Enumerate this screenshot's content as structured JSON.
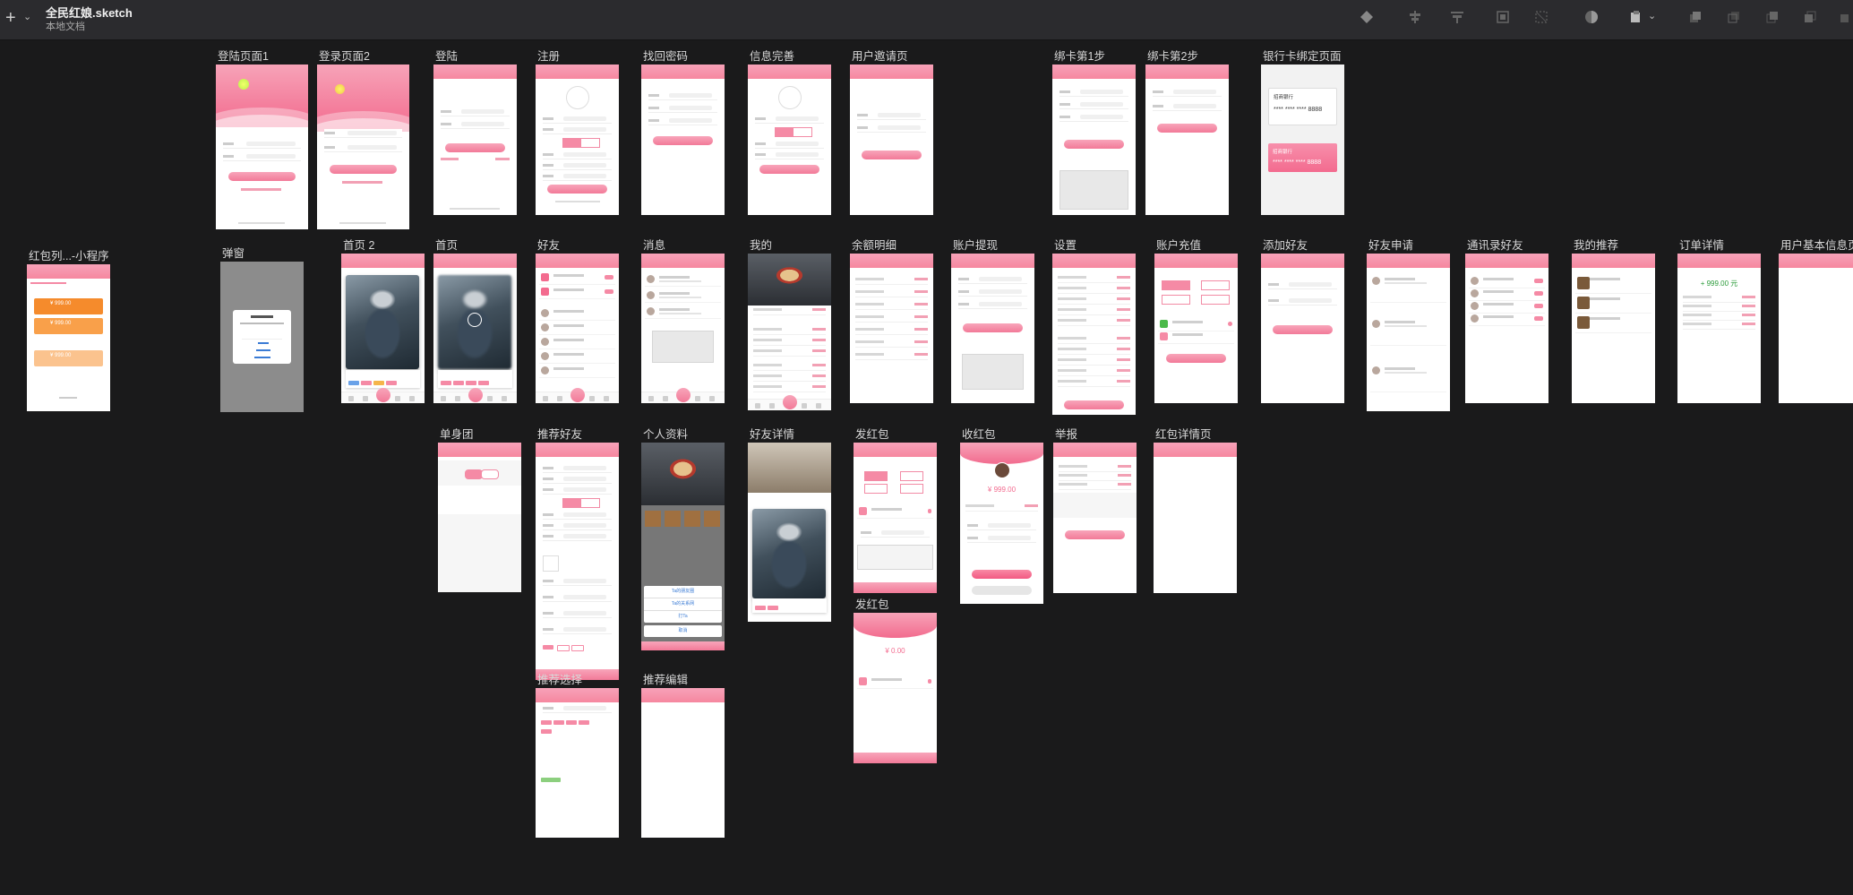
{
  "app": {
    "document_title": "全民红娘.sketch",
    "document_subtitle": "本地文档"
  },
  "toolbar": {
    "add_icon": "plus-icon",
    "icons": [
      "insert-icon",
      "align-icon",
      "distribute-icon",
      "group-icon",
      "ungroup-icon",
      "mask-icon",
      "boolean-icon",
      "forward-icon",
      "backward-icon",
      "front-icon",
      "back-icon"
    ]
  },
  "artboards": {
    "login1": {
      "label": "登陆页面1"
    },
    "login2": {
      "label": "登录页面2"
    },
    "login": {
      "label": "登陆"
    },
    "register": {
      "label": "注册"
    },
    "find_pwd": {
      "label": "找回密码"
    },
    "info_complete": {
      "label": "信息完善"
    },
    "invite": {
      "label": "用户邀请页"
    },
    "bind_step1": {
      "label": "绑卡第1步"
    },
    "bind_step2": {
      "label": "绑卡第2步"
    },
    "bank_bind": {
      "label": "银行卡绑定页面",
      "bank1": "招商银行",
      "card1": "**** **** **** 8888",
      "bank2": "招商银行",
      "card2": "**** **** **** 8888"
    },
    "redpacket_list": {
      "label": "红包列...-小程序",
      "amount1": "¥ 999.00",
      "amount2": "¥ 999.00",
      "amount3": "¥ 999.00"
    },
    "popup": {
      "label": "弹窗"
    },
    "home2": {
      "label": "首页 2"
    },
    "home": {
      "label": "首页"
    },
    "friends": {
      "label": "好友"
    },
    "messages": {
      "label": "消息"
    },
    "mine": {
      "label": "我的"
    },
    "balance": {
      "label": "余额明细"
    },
    "withdraw": {
      "label": "账户提现"
    },
    "settings": {
      "label": "设置"
    },
    "recharge": {
      "label": "账户充值"
    },
    "add_friend": {
      "label": "添加好友"
    },
    "friend_request": {
      "label": "好友申请"
    },
    "contacts": {
      "label": "通讯录好友"
    },
    "my_recommend": {
      "label": "我的推荐"
    },
    "order_detail": {
      "label": "订单详情",
      "amount": "+ 999.00 元"
    },
    "user_info": {
      "label": "用户基本信息页"
    },
    "singles": {
      "label": "单身团"
    },
    "recommend_friend": {
      "label": "推荐好友"
    },
    "profile": {
      "label": "个人资料",
      "sheet_item1": "Ta的朋友圈",
      "sheet_item2": "Ta的关系网",
      "sheet_item3": "打Ta",
      "sheet_cancel": "取消"
    },
    "friend_detail": {
      "label": "好友详情"
    },
    "send_red": {
      "label": "发红包"
    },
    "receive_red": {
      "label": "收红包",
      "amount": "¥ 999.00"
    },
    "report": {
      "label": "举报"
    },
    "red_detail": {
      "label": "红包详情页"
    },
    "recommend_select": {
      "label": "推荐选择"
    },
    "recommend_edit": {
      "label": "推荐编辑"
    },
    "send_red2": {
      "label": "发红包",
      "amount": "¥ 0.00"
    }
  }
}
